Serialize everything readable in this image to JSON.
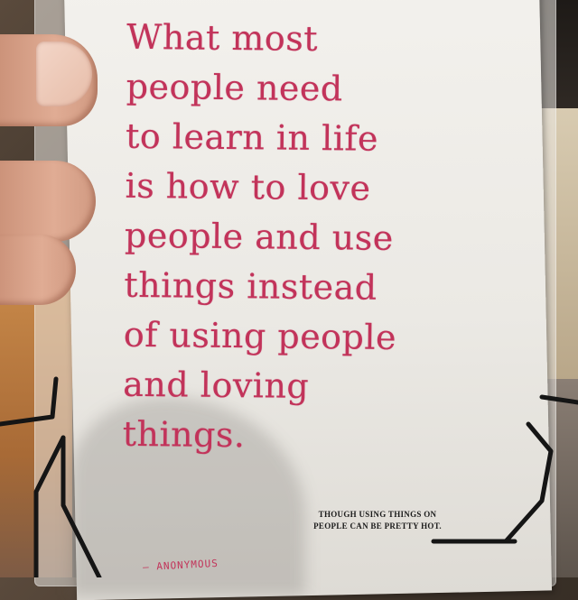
{
  "card": {
    "quote_lines": [
      "What most",
      "people need",
      "to learn in life",
      "is how to love",
      "people and use",
      "things instead",
      "of using people",
      "and loving",
      "things."
    ],
    "footnote_lines": [
      "THOUGH USING THINGS ON",
      "PEOPLE CAN BE PRETTY HOT."
    ],
    "attribution": "— ANONYMOUS"
  },
  "colors": {
    "quote_ink": "#c2335a",
    "card_paper": "#f1efea"
  }
}
